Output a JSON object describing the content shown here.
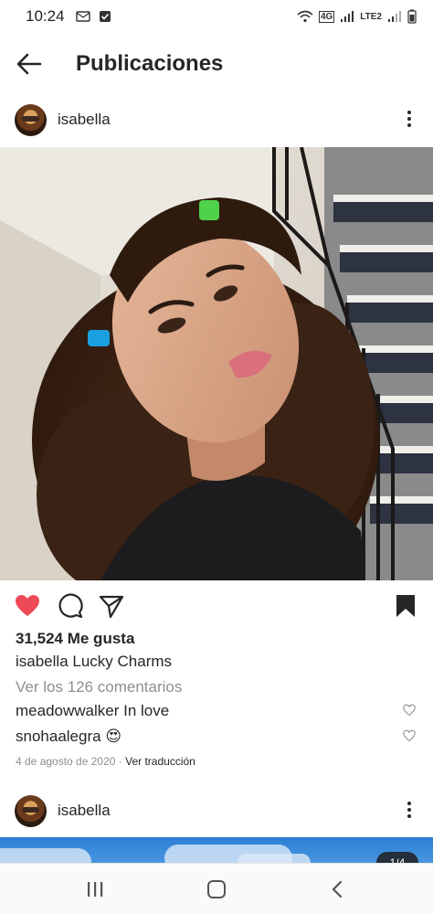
{
  "status_bar": {
    "time": "10:24",
    "network_label_1": "4G",
    "network_label_2": "LTE2",
    "left_icons": [
      "outlook-icon",
      "checkbox-icon"
    ],
    "right_icons": [
      "wifi-icon",
      "signal-icon",
      "signal-icon",
      "battery-icon"
    ]
  },
  "header": {
    "title": "Publicaciones"
  },
  "post": {
    "username": "isabella",
    "likes": "31,524 Me gusta",
    "caption_user": "isabella",
    "caption_text": "Lucky Charms",
    "view_comments": "Ver los 126 comentarios",
    "comments": [
      {
        "user": "meadowwalker",
        "text": "In love"
      },
      {
        "user": "snohaalegra",
        "text": "😍"
      }
    ],
    "date": "4 de agosto de 2020",
    "translate": "Ver traducción",
    "liked": true,
    "saved": true
  },
  "next_post": {
    "username": "isabella",
    "counter": "1/4"
  },
  "colors": {
    "like_red": "#ed4956",
    "text": "#262626",
    "muted": "#8e8e8e"
  }
}
